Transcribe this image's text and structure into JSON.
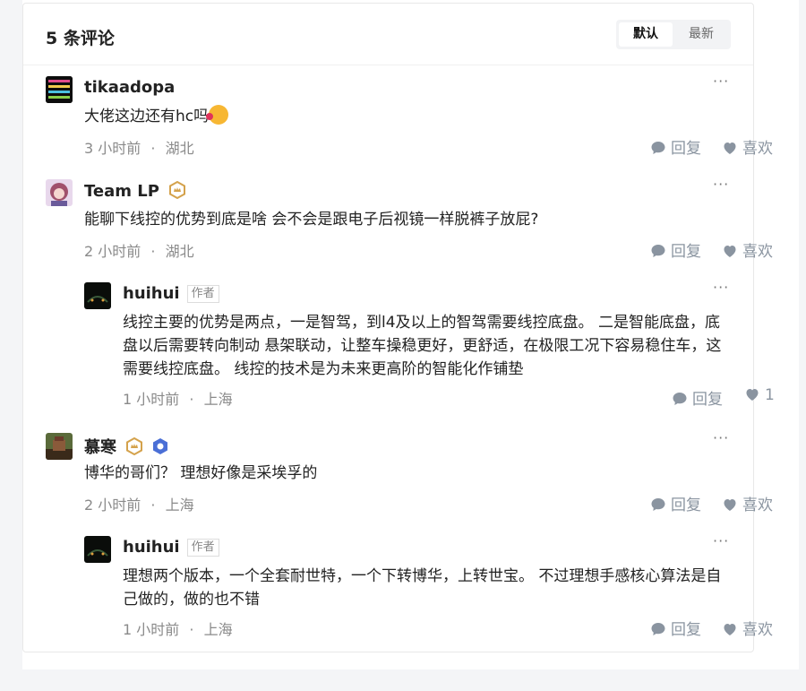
{
  "header": {
    "title": "5 条评论",
    "sort_default": "默认",
    "sort_latest": "最新"
  },
  "comments": [
    {
      "author": "tikaadopa",
      "text": "大佬这边还有hc吗",
      "time": "3 小时前",
      "location": "湖北",
      "reply_label": "回复",
      "like_label": "喜欢"
    },
    {
      "author": "Team LP",
      "text": "能聊下线控的优势到底是啥 会不会是跟电子后视镜一样脱裤子放屁?",
      "time": "2 小时前",
      "location": "湖北",
      "reply_label": "回复",
      "like_label": "喜欢"
    },
    {
      "author": "huihui",
      "author_tag": "作者",
      "text": "线控主要的优势是两点，一是智驾，到l4及以上的智驾需要线控底盘。 二是智能底盘，底盘以后需要转向制动 悬架联动，让整车操稳更好，更舒适，在极限工况下容易稳住车，这需要线控底盘。 线控的技术是为未来更高阶的智能化作铺垫",
      "time": "1 小时前",
      "location": "上海",
      "reply_label": "回复",
      "like_label": "1"
    },
    {
      "author": "慕寒",
      "text": "博华的哥们？ 理想好像是采埃孚的",
      "time": "2 小时前",
      "location": "上海",
      "reply_label": "回复",
      "like_label": "喜欢"
    },
    {
      "author": "huihui",
      "author_tag": "作者",
      "text": "理想两个版本，一个全套耐世特，一个下转博华，上转世宝。 不过理想手感核心算法是自己做的，做的也不错",
      "time": "1 小时前",
      "location": "上海",
      "reply_label": "回复",
      "like_label": "喜欢"
    }
  ],
  "separator": "·",
  "more_label": "···",
  "colors": {
    "action": "#8a94a0",
    "meta": "#8a8a8a",
    "badge_gold": "#d4a24c",
    "badge_blue": "#4a6fd6"
  }
}
